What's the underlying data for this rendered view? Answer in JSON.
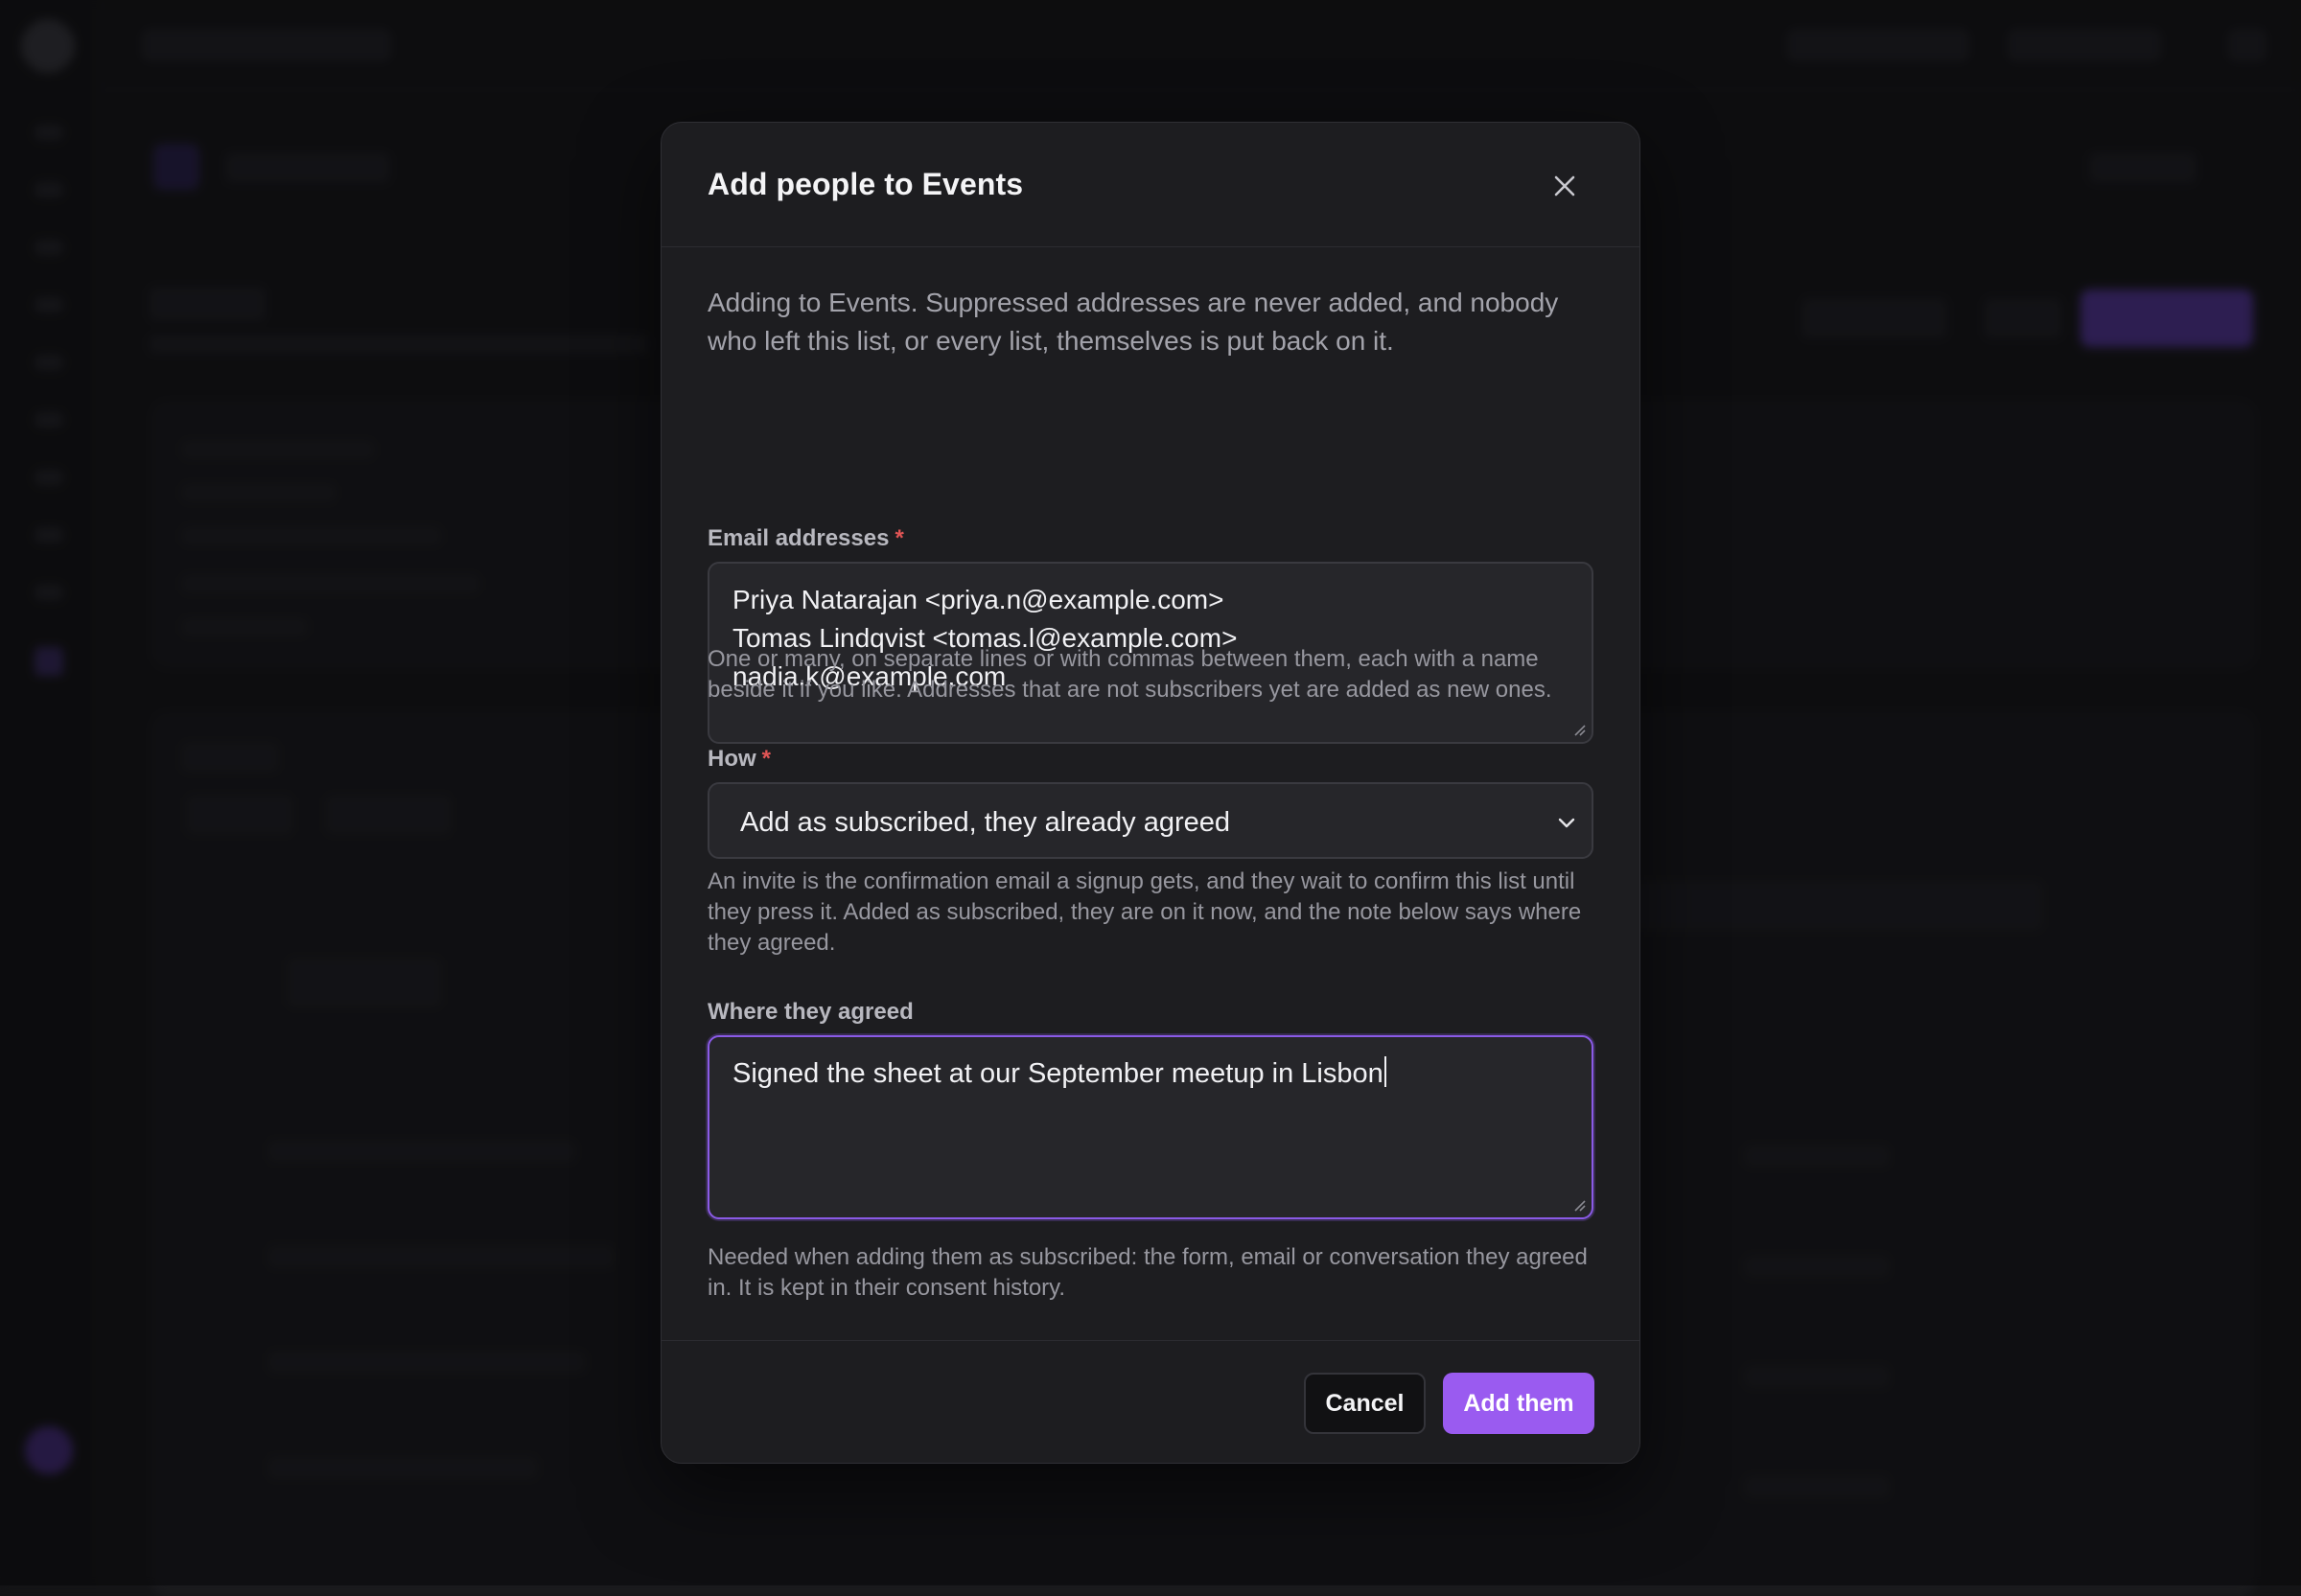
{
  "modal": {
    "title": "Add people to Events",
    "intro": "Adding to Events. Suppressed addresses are never added, and nobody who left this list, or every list, themselves is put back on it.",
    "emails": {
      "label": "Email addresses",
      "required_mark": "*",
      "lines": [
        "Priya Natarajan <priya.n@example.com>",
        "Tomas Lindqvist <tomas.l@example.com>",
        "nadia.k@example.com"
      ],
      "help": "One or many, on separate lines or with commas between them, each with a name beside it if you like. Addresses that are not subscribers yet are added as new ones."
    },
    "how": {
      "label": "How",
      "required_mark": "*",
      "selected": "Add as subscribed, they already agreed",
      "help": "An invite is the confirmation email a signup gets, and they wait to confirm this list until they press it. Added as subscribed, they are on it now, and the note below says where they agreed."
    },
    "where": {
      "label": "Where they agreed",
      "value": "Signed the sheet at our September meetup in Lisbon",
      "help": "Needed when adding them as subscribed: the form, email or conversation they agreed in. It is kept in their consent history."
    },
    "buttons": {
      "cancel": "Cancel",
      "submit": "Add them"
    }
  },
  "colors": {
    "accent": "#9a5bf0",
    "focus_border": "#8a5ae6",
    "required": "#e15555",
    "modal_bg": "#1d1d20"
  },
  "icons": {
    "close": "close-icon",
    "select": "chevron-down-icon",
    "resize": "resize-handle-icon"
  }
}
